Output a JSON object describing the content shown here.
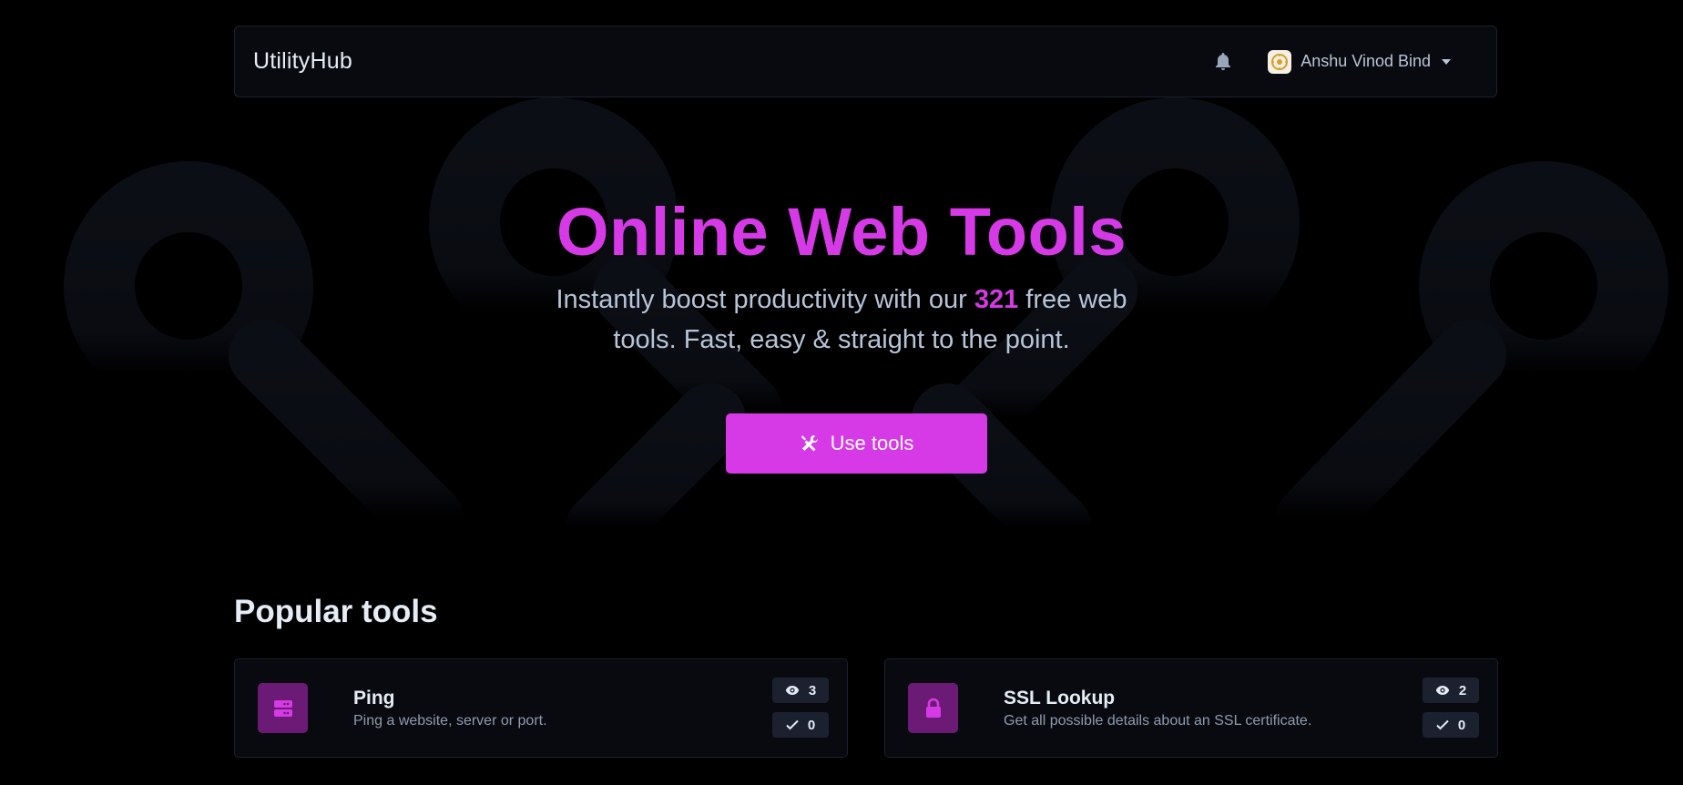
{
  "navbar": {
    "brand": "UtilityHub",
    "user_name": "Anshu Vinod Bind",
    "icons": [
      "bell-icon",
      "avatar",
      "caret-down-icon"
    ]
  },
  "hero": {
    "title": "Online Web Tools",
    "subtitle_before": "Instantly boost productivity with our ",
    "tool_count": "321",
    "subtitle_after": " free web tools. Fast, easy & straight to the point.",
    "cta_label": "Use tools",
    "cta_icon": "tools-icon"
  },
  "popular": {
    "title": "Popular tools",
    "tools": [
      {
        "name": "Ping",
        "description": "Ping a website, server or port.",
        "views": "3",
        "uses": "0",
        "icon": "server-icon"
      },
      {
        "name": "SSL Lookup",
        "description": "Get all possible details about an SSL certificate.",
        "views": "2",
        "uses": "0",
        "icon": "lock-icon"
      }
    ]
  },
  "colors": {
    "accent": "#d63ae6",
    "background": "#000000",
    "card": "#090a0f",
    "tool_icon_bg": "#6b1a75"
  }
}
